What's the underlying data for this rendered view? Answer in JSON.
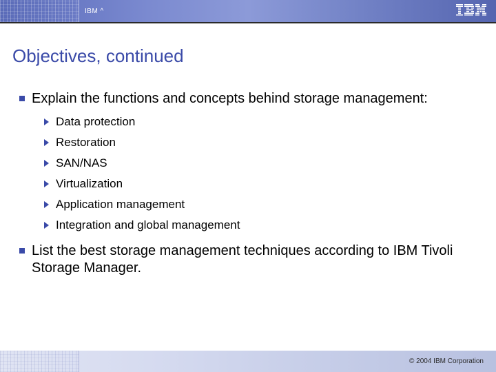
{
  "header": {
    "brand": "IBM ^",
    "logo_name": "ibm-logo"
  },
  "title": "Objectives, continued",
  "bullets": [
    {
      "text": "Explain the functions and concepts behind storage management:",
      "children": [
        "Data protection",
        "Restoration",
        "SAN/NAS",
        "Virtualization",
        "Application management",
        "Integration and global management"
      ]
    },
    {
      "text": "List the best storage management techniques according to IBM Tivoli Storage Manager.",
      "children": []
    }
  ],
  "footer": {
    "copyright": "© 2004 IBM Corporation"
  },
  "colors": {
    "accent": "#3a4aa8"
  }
}
